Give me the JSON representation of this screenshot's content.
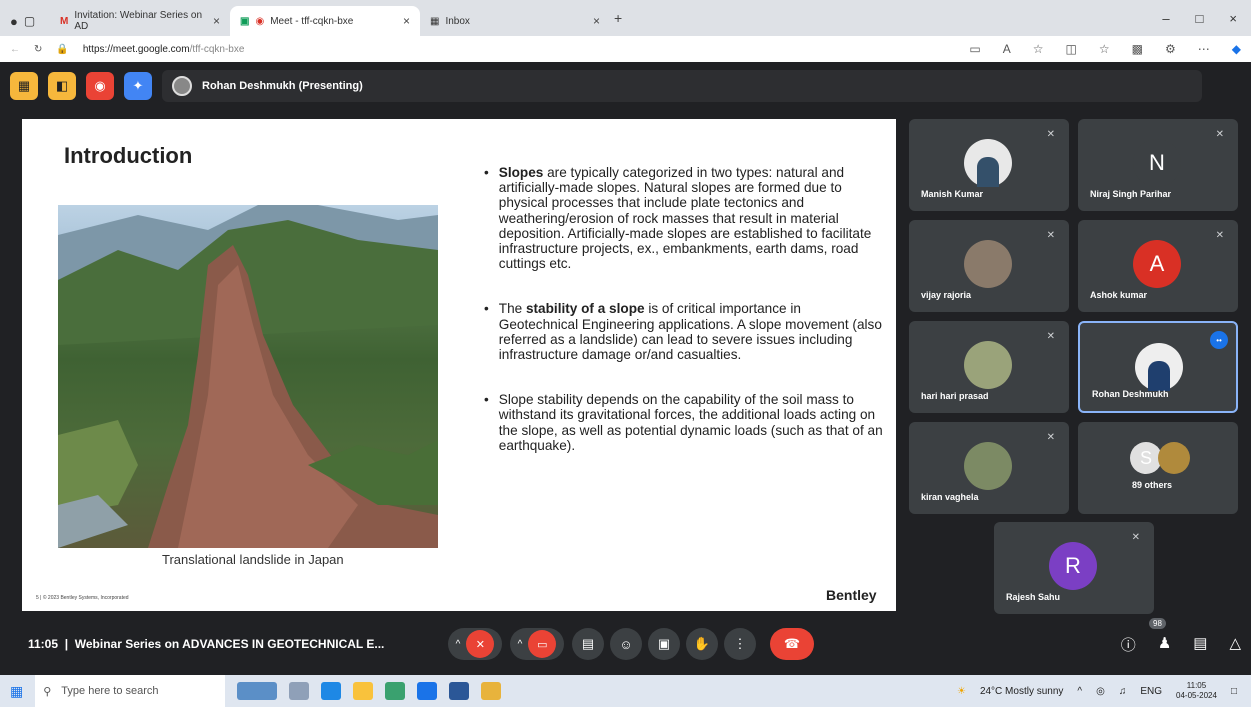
{
  "browser": {
    "tabs": [
      {
        "label": "Invitation: Webinar Series on AD",
        "icon": "gmail-icon"
      },
      {
        "label": "Meet - tff-cqkn-bxe",
        "icon": "meet-icon"
      },
      {
        "label": "Inbox",
        "icon": "inbox-icon"
      }
    ],
    "url_host": "https://meet.google.com",
    "url_path": "/tff-cqkn-bxe"
  },
  "meet": {
    "presenting_label": "Rohan Deshmukh (Presenting)",
    "top_buttons": [
      "layout-icon",
      "captions-icon",
      "record-icon",
      "activities-icon"
    ],
    "meeting_time": "11:05",
    "meeting_title": "Webinar Series on ADVANCES IN GEOTECHNICAL E...",
    "people_count": "98"
  },
  "slide": {
    "title": "Introduction",
    "caption": "Translational landslide in Japan",
    "footnote": "5  |  © 2023 Bentley Systems, Incorporated",
    "brand": "Bentley",
    "bullets": [
      {
        "strong": "Slopes",
        "text": " are typically categorized in two types: natural and artificially-made slopes. Natural slopes are formed due to physical processes that include plate tectonics and weathering/erosion of rock masses that result in material deposition. Artificially-made slopes are established to facilitate infrastructure projects, ex., embankments, earth dams, road cuttings etc."
      },
      {
        "pre": "The ",
        "strong": "stability of a slope",
        "text": " is of critical importance in Geotechnical Engineering applications. A slope movement (also referred as a landslide) can lead to severe issues including infrastructure damage or/and casualties."
      },
      {
        "pre": "",
        "strong": "",
        "text": "Slope stability depends on the capability of the soil mass to withstand its gravitational forces, the additional loads acting on the slope, as well as potential dynamic loads (such as that of an earthquake)."
      }
    ]
  },
  "participants": [
    {
      "name": "Manish Kumar",
      "initial": "",
      "color": "#e8e8e8"
    },
    {
      "name": "Niraj Singh Parihar",
      "initial": "N",
      "color": "#3c4043"
    },
    {
      "name": "vijay rajoria",
      "initial": "",
      "color": "#8a7a6a"
    },
    {
      "name": "Ashok kumar",
      "initial": "A",
      "color": "#d93025"
    },
    {
      "name": "hari hari prasad",
      "initial": "",
      "color": "#9aa37a"
    },
    {
      "name": "Rohan Deshmukh",
      "initial": "",
      "color": "#eeeeee"
    },
    {
      "name": "kiran vaghela",
      "initial": "",
      "color": "#7c8a64"
    },
    {
      "name": "89 others",
      "initial": "S",
      "color": "#e0e0e0"
    },
    {
      "name": "Rajesh Sahu",
      "initial": "R",
      "color": "#7b3fc4"
    }
  ],
  "taskbar": {
    "search_placeholder": "Type here to search",
    "weather": "24°C  Mostly sunny",
    "lang": "ENG",
    "time": "11:05",
    "date": "04-05-2024"
  }
}
